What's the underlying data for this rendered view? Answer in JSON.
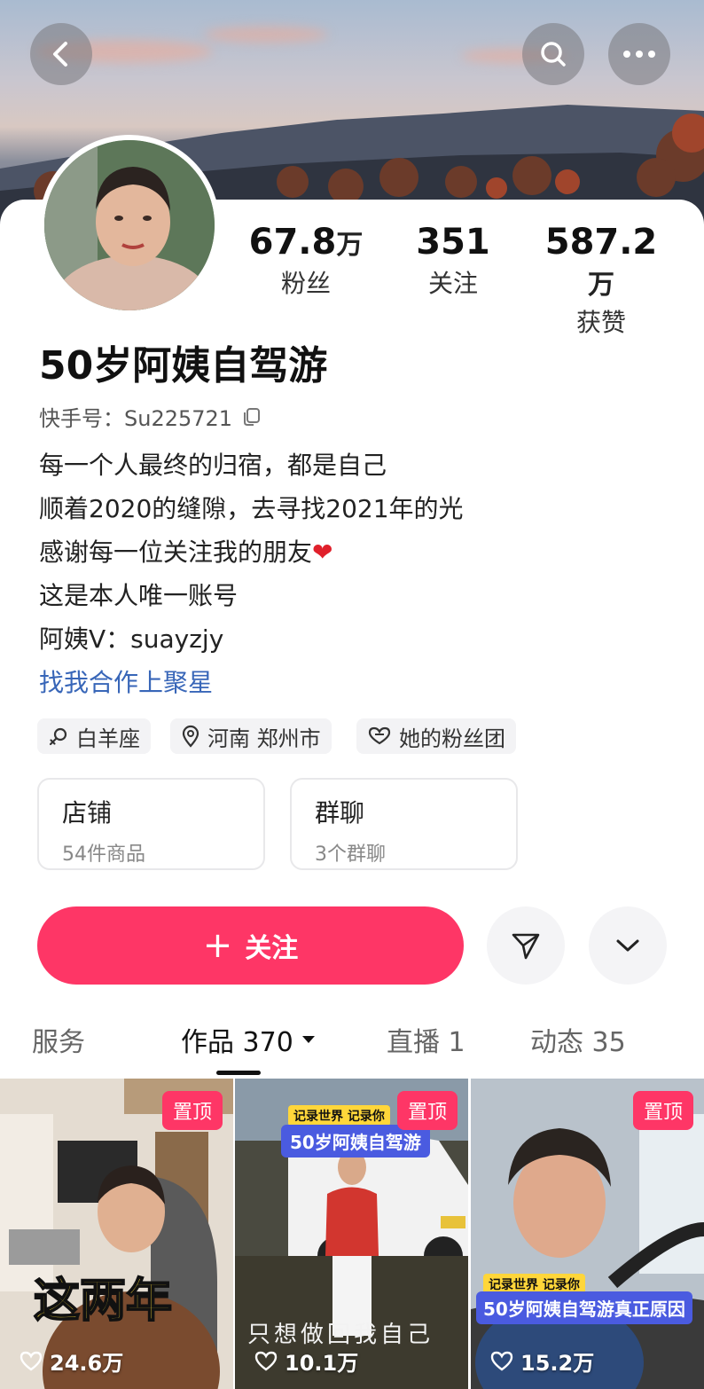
{
  "header": {
    "back_icon": "chevron-left-icon",
    "search_icon": "search-icon",
    "more_icon": "more-horizontal-icon"
  },
  "profile": {
    "stats": [
      {
        "value": "67.8",
        "unit": "万",
        "label": "粉丝"
      },
      {
        "value": "351",
        "unit": "",
        "label": "关注"
      },
      {
        "value": "587.2",
        "unit": "万",
        "label": "获赞"
      }
    ],
    "nickname": "50岁阿姨自驾游",
    "kwai_id_label": "快手号：",
    "kwai_id_value": "Su225721",
    "bio_lines": [
      "每一个人最终的归宿，都是自己",
      "顺着2020的缝隙，去寻找2021年的光",
      "感谢每一位关注我的朋友",
      "这是本人唯一账号",
      "阿姨V：suayzjy"
    ],
    "bio_heart": "❤",
    "collab_link": "找我合作上聚星"
  },
  "tags": [
    {
      "icon": "gender-female-icon",
      "label": "白羊座"
    },
    {
      "icon": "location-pin-icon",
      "label": "河南 郑州市"
    },
    {
      "icon": "fan-club-icon",
      "label": "她的粉丝团"
    }
  ],
  "cards": [
    {
      "title": "店铺",
      "subtitle": "54件商品"
    },
    {
      "title": "群聊",
      "subtitle": "3个群聊"
    }
  ],
  "actions": {
    "follow_plus": "+",
    "follow_label": "关注",
    "share_icon": "send-icon",
    "expand_icon": "chevron-down-icon"
  },
  "tabs": [
    {
      "label": "服务"
    },
    {
      "label": "作品 370",
      "active": true
    },
    {
      "label": "直播 1"
    },
    {
      "label": "动态 35"
    }
  ],
  "videos": [
    {
      "pin": "置顶",
      "likes": "24.6万",
      "overlay": "这两年"
    },
    {
      "pin": "置顶",
      "likes": "10.1万",
      "banner_top": "记录世界 记录你",
      "banner_main": "50岁阿姨自驾游",
      "caption": "只想做回我自己"
    },
    {
      "pin": "置顶",
      "likes": "15.2万",
      "banner_top": "记录世界 记录你",
      "banner_main": "50岁阿姨自驾游真正原因"
    }
  ],
  "colors": {
    "accent": "#fe3666",
    "link": "#3866b8"
  }
}
